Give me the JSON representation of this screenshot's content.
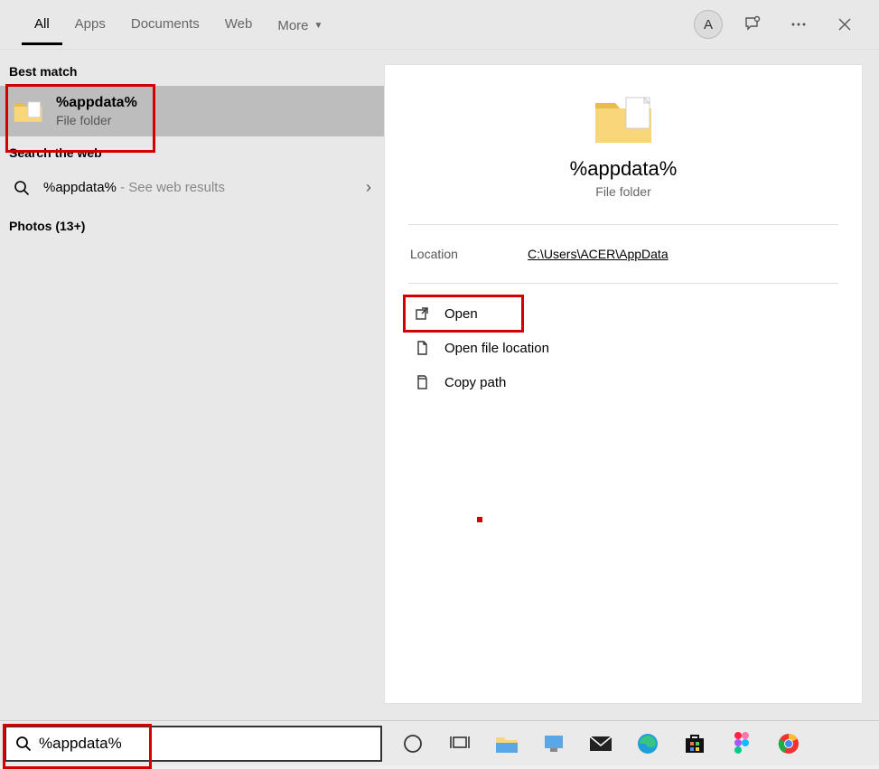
{
  "tabs": {
    "items": [
      "All",
      "Apps",
      "Documents",
      "Web",
      "More"
    ],
    "active_index": 0
  },
  "avatar_letter": "A",
  "left": {
    "best_match_label": "Best match",
    "best_match": {
      "title": "%appdata%",
      "subtitle": "File folder"
    },
    "web_label": "Search the web",
    "web_item": {
      "query": "%appdata%",
      "suffix": " - See web results"
    },
    "photos_label": "Photos (13+)"
  },
  "preview": {
    "title": "%appdata%",
    "subtitle": "File folder",
    "location_label": "Location",
    "location_value": "C:\\Users\\ACER\\AppData",
    "actions": {
      "open": "Open",
      "open_location": "Open file location",
      "copy_path": "Copy path"
    }
  },
  "search": {
    "value": "%appdata%"
  }
}
